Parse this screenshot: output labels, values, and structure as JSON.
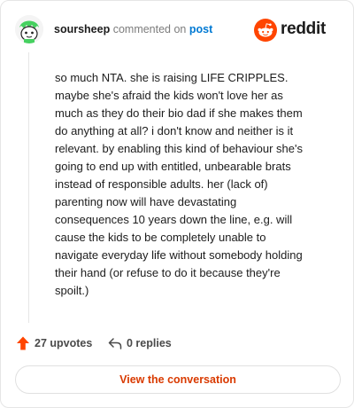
{
  "header": {
    "username": "soursheep",
    "action_text": "commented on",
    "post_link": "post",
    "brand": "reddit"
  },
  "comment": {
    "body": "so much NTA. she is raising LIFE CRIPPLES.\nmaybe she's afraid the kids won't love her as\nmuch as they do their bio dad if she makes them\ndo anything at all? i don't know and neither is it\nrelevant. by enabling this kind of behaviour she's\ngoing to end up with entitled, unbearable brats\ninstead of responsible adults. her (lack of)\nparenting now will have devastating\nconsequences 10 years down the line, e.g. will\ncause the kids to be completely unable to\nnavigate everyday life without somebody holding\ntheir hand (or refuse to do it because they're\nspoilt.)"
  },
  "stats": {
    "upvotes": "27 upvotes",
    "replies": "0 replies"
  },
  "footer": {
    "button_label": "View the conversation"
  },
  "colors": {
    "brand": "#ff4500",
    "link": "#0079d3",
    "button_text": "#d93a00",
    "avatar_green": "#46d160"
  },
  "icons": [
    "avatar-snoo-icon",
    "reddit-logo-icon",
    "upvote-arrow-icon",
    "reply-arrow-icon"
  ]
}
